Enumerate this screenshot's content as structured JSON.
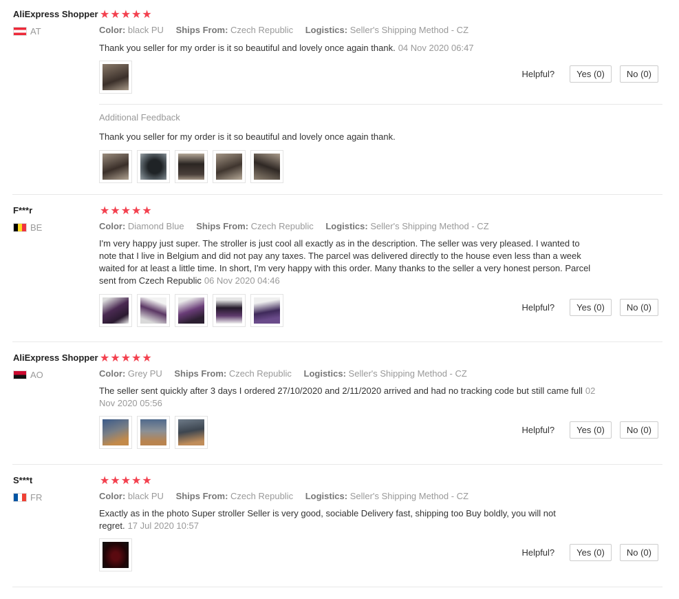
{
  "labels": {
    "color": "Color:",
    "ships_from": "Ships From:",
    "logistics": "Logistics:",
    "helpful": "Helpful?",
    "additional_feedback": "Additional Feedback"
  },
  "stars_text": "★★★★★",
  "reviews": [
    {
      "user": "AliExpress Shopper",
      "country": "AT",
      "color": "black PU",
      "ships_from": "Czech Republic",
      "logistics": "Seller's Shipping Method - CZ",
      "text": "Thank you seller for my order is it so beautiful and lovely once again thank.",
      "date": "04 Nov 2020 06:47",
      "yes": "Yes (0)",
      "no": "No (0)",
      "additional_text": "Thank you seller for my order is it so beautiful and lovely once again thank."
    },
    {
      "user": "F***r",
      "country": "BE",
      "color": "Diamond Blue",
      "ships_from": "Czech Republic",
      "logistics": "Seller's Shipping Method - CZ",
      "text": "I'm very happy just super. The stroller is just cool all exactly as in the description. The seller was very pleased. I wanted to note that I live in Belgium and did not pay any taxes. The parcel was delivered directly to the house even less than a week waited for at least a little time. In short, I'm very happy with this order. Many thanks to the seller a very honest person. Parcel sent from Czech Republic",
      "date": "06 Nov 2020 04:46",
      "yes": "Yes (0)",
      "no": "No (0)"
    },
    {
      "user": "AliExpress Shopper",
      "country": "AO",
      "color": "Grey PU",
      "ships_from": "Czech Republic",
      "logistics": "Seller's Shipping Method - CZ",
      "text": "The seller sent quickly after 3 days I ordered 27/10/2020 and 2/11/2020 arrived and had no tracking code but still came full",
      "date": "02 Nov 2020 05:56",
      "yes": "Yes (0)",
      "no": "No (0)"
    },
    {
      "user": "S***t",
      "country": "FR",
      "color": "black PU",
      "ships_from": "Czech Republic",
      "logistics": "Seller's Shipping Method - CZ",
      "text": "Exactly as in the photo Super stroller Seller is very good, sociable Delivery fast, shipping too Buy boldly, you will not regret.",
      "date": "17 Jul 2020 10:57",
      "yes": "Yes (0)",
      "no": "No (0)"
    }
  ]
}
